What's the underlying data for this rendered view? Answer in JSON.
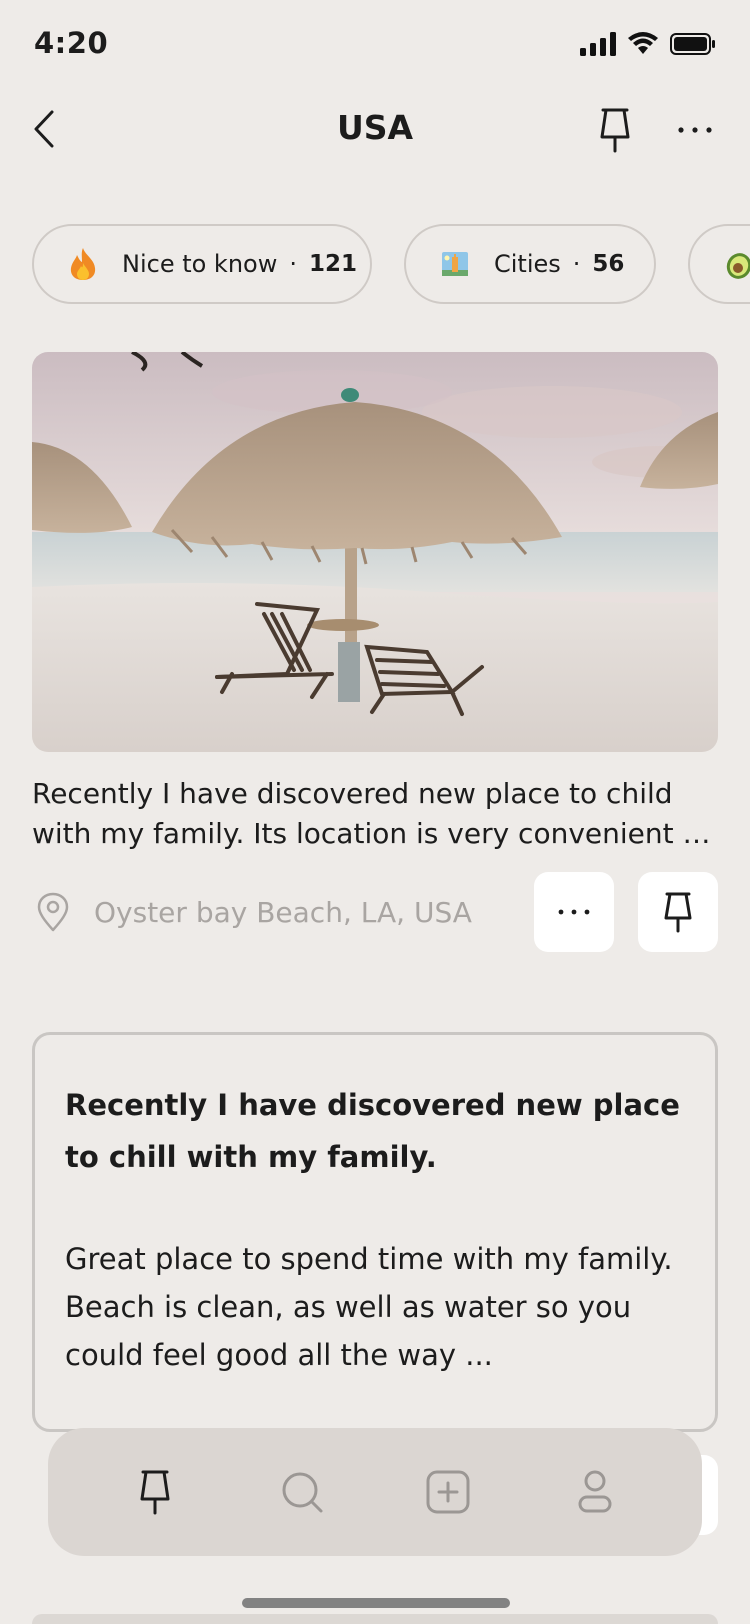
{
  "status_bar": {
    "time": "4:20"
  },
  "header": {
    "title": "USA"
  },
  "chips": [
    {
      "icon": "fire-icon",
      "label": "Nice to know",
      "count": "121"
    },
    {
      "icon": "city-postcard-icon",
      "label": "Cities",
      "count": "56"
    },
    {
      "icon": "avocado-icon"
    }
  ],
  "post": {
    "description_line1": "Recently I have discovered new place to child",
    "description_line2": "with my family. Its location is very convenient m...",
    "location": "Oyster bay Beach, LA, USA"
  },
  "note_card": {
    "title": "Recently I have discovered new place to chill with my family.",
    "body": "Great place to spend time with my family. Beach is clean, as well as water so you could feel good all the way ..."
  },
  "tab_bar": {
    "tabs": [
      "pin-icon",
      "search-icon",
      "add-icon",
      "profile-icon"
    ],
    "active": "pin-icon"
  },
  "colors": {
    "background": "#eeebe8",
    "card_border": "#c9c6c3",
    "muted_text": "#a9a5a2",
    "tab_bar": "#dbd6d2"
  }
}
